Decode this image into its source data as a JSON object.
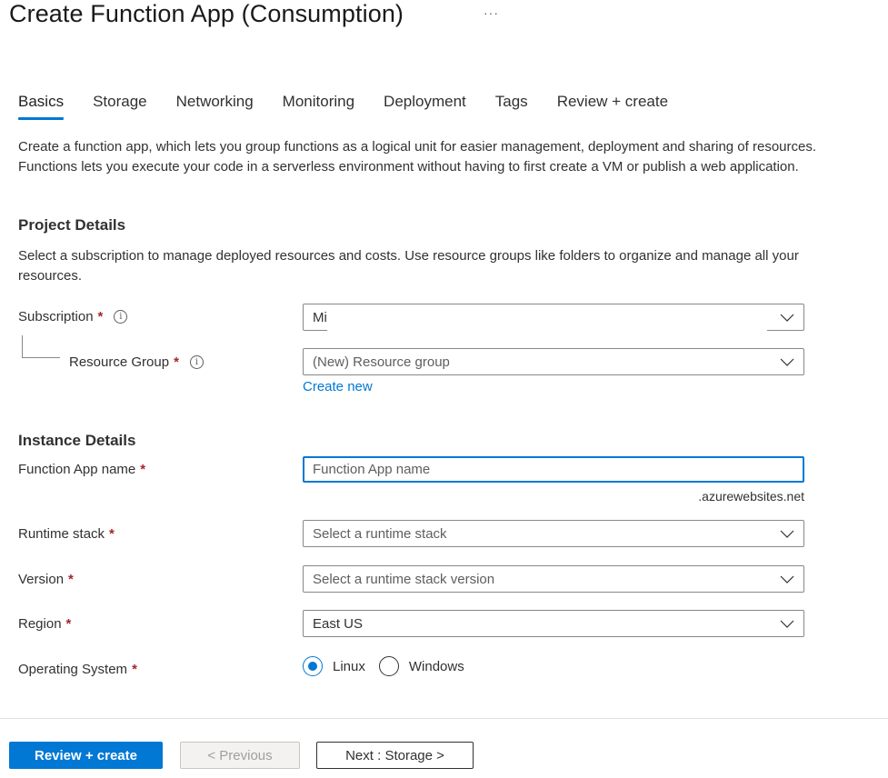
{
  "header": {
    "title": "Create Function App (Consumption)",
    "more_label": "···"
  },
  "tabs": [
    {
      "label": "Basics",
      "active": true
    },
    {
      "label": "Storage",
      "active": false
    },
    {
      "label": "Networking",
      "active": false
    },
    {
      "label": "Monitoring",
      "active": false
    },
    {
      "label": "Deployment",
      "active": false
    },
    {
      "label": "Tags",
      "active": false
    },
    {
      "label": "Review + create",
      "active": false
    }
  ],
  "intro": "Create a function app, which lets you group functions as a logical unit for easier management, deployment and sharing of resources. Functions lets you execute your code in a serverless environment without having to first create a VM or publish a web application.",
  "project_details": {
    "title": "Project Details",
    "description": "Select a subscription to manage deployed resources and costs. Use resource groups like folders to organize and manage all your resources.",
    "subscription": {
      "label": "Subscription",
      "required": "*",
      "info_icon": "i",
      "value": "Mi"
    },
    "resource_group": {
      "label": "Resource Group",
      "required": "*",
      "info_icon": "i",
      "value": "(New) Resource group",
      "create_new": "Create new"
    }
  },
  "instance_details": {
    "title": "Instance Details",
    "function_app_name": {
      "label": "Function App name",
      "required": "*",
      "placeholder": "Function App name",
      "value": "",
      "suffix": ".azurewebsites.net"
    },
    "runtime_stack": {
      "label": "Runtime stack",
      "required": "*",
      "placeholder": "Select a runtime stack"
    },
    "version": {
      "label": "Version",
      "required": "*",
      "placeholder": "Select a runtime stack version"
    },
    "region": {
      "label": "Region",
      "required": "*",
      "value": "East US"
    },
    "operating_system": {
      "label": "Operating System",
      "required": "*",
      "options": [
        {
          "label": "Linux",
          "checked": true
        },
        {
          "label": "Windows",
          "checked": false
        }
      ]
    }
  },
  "footer": {
    "review_create": "Review + create",
    "previous": "< Previous",
    "next": "Next : Storage >"
  },
  "colors": {
    "accent": "#0078d4",
    "required": "#a4262c",
    "text": "#323130"
  }
}
